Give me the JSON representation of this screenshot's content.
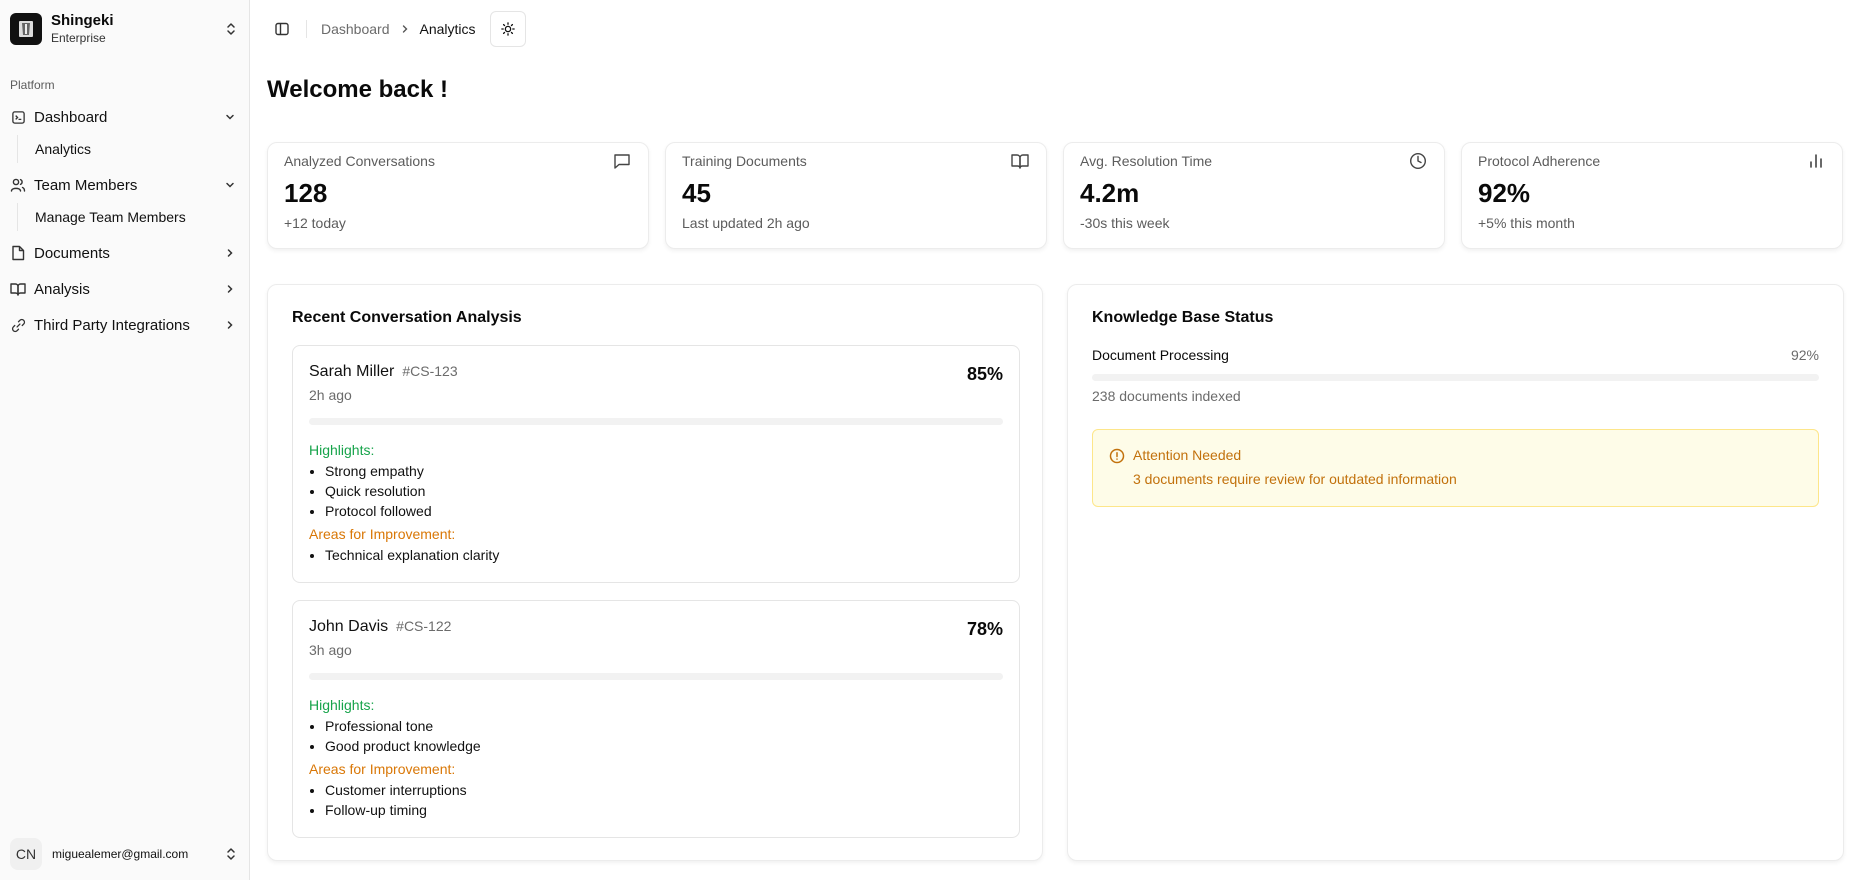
{
  "sidebar": {
    "org": {
      "name": "Shingeki",
      "plan": "Enterprise",
      "logo_icon": "shield-logo-icon"
    },
    "group_label": "Platform",
    "items": [
      {
        "label": "Dashboard",
        "icon": "dashboard-icon",
        "expanded": true,
        "children": [
          "Analytics"
        ]
      },
      {
        "label": "Team Members",
        "icon": "users-icon",
        "expanded": true,
        "children": [
          "Manage Team Members"
        ]
      },
      {
        "label": "Documents",
        "icon": "file-icon",
        "expanded": false
      },
      {
        "label": "Analysis",
        "icon": "book-icon",
        "expanded": false
      },
      {
        "label": "Third Party Integrations",
        "icon": "link-icon",
        "expanded": false
      }
    ],
    "user": {
      "initials": "CN",
      "email": "miguealemer@gmail.com"
    }
  },
  "header": {
    "breadcrumb": [
      "Dashboard",
      "Analytics"
    ],
    "theme_icon": "sun-icon"
  },
  "page": {
    "welcome": "Welcome back !"
  },
  "stats": [
    {
      "title": "Analyzed Conversations",
      "value": "128",
      "sub": "+12 today",
      "icon": "message-icon"
    },
    {
      "title": "Training Documents",
      "value": "45",
      "sub": "Last updated 2h ago",
      "icon": "book-open-icon"
    },
    {
      "title": "Avg. Resolution Time",
      "value": "4.2m",
      "sub": "-30s this week",
      "icon": "clock-icon"
    },
    {
      "title": "Protocol Adherence",
      "value": "92%",
      "sub": "+5% this month",
      "icon": "bar-chart-icon"
    }
  ],
  "recent": {
    "title": "Recent Conversation Analysis",
    "highlights_label": "Highlights:",
    "improvement_label": "Areas for Improvement:",
    "conversations": [
      {
        "name": "Sarah Miller",
        "id": "#CS-123",
        "time": "2h ago",
        "score": "85%",
        "highlights": [
          "Strong empathy",
          "Quick resolution",
          "Protocol followed"
        ],
        "improvements": [
          "Technical explanation clarity"
        ]
      },
      {
        "name": "John Davis",
        "id": "#CS-122",
        "time": "3h ago",
        "score": "78%",
        "highlights": [
          "Professional tone",
          "Good product knowledge"
        ],
        "improvements": [
          "Customer interruptions",
          "Follow-up timing"
        ]
      }
    ]
  },
  "knowledge": {
    "title": "Knowledge Base Status",
    "processing_label": "Document Processing",
    "processing_pct": "92%",
    "indexed": "238 documents indexed",
    "alert": {
      "title": "Attention Needed",
      "description": "3 documents require review for outdated information",
      "icon": "alert-circle-icon"
    }
  },
  "colors": {
    "highlight": "#16a34a",
    "improvement": "#d97706",
    "alert_bg": "#fefce8",
    "alert_border": "#fde68a",
    "alert_text": "#c2710c"
  }
}
